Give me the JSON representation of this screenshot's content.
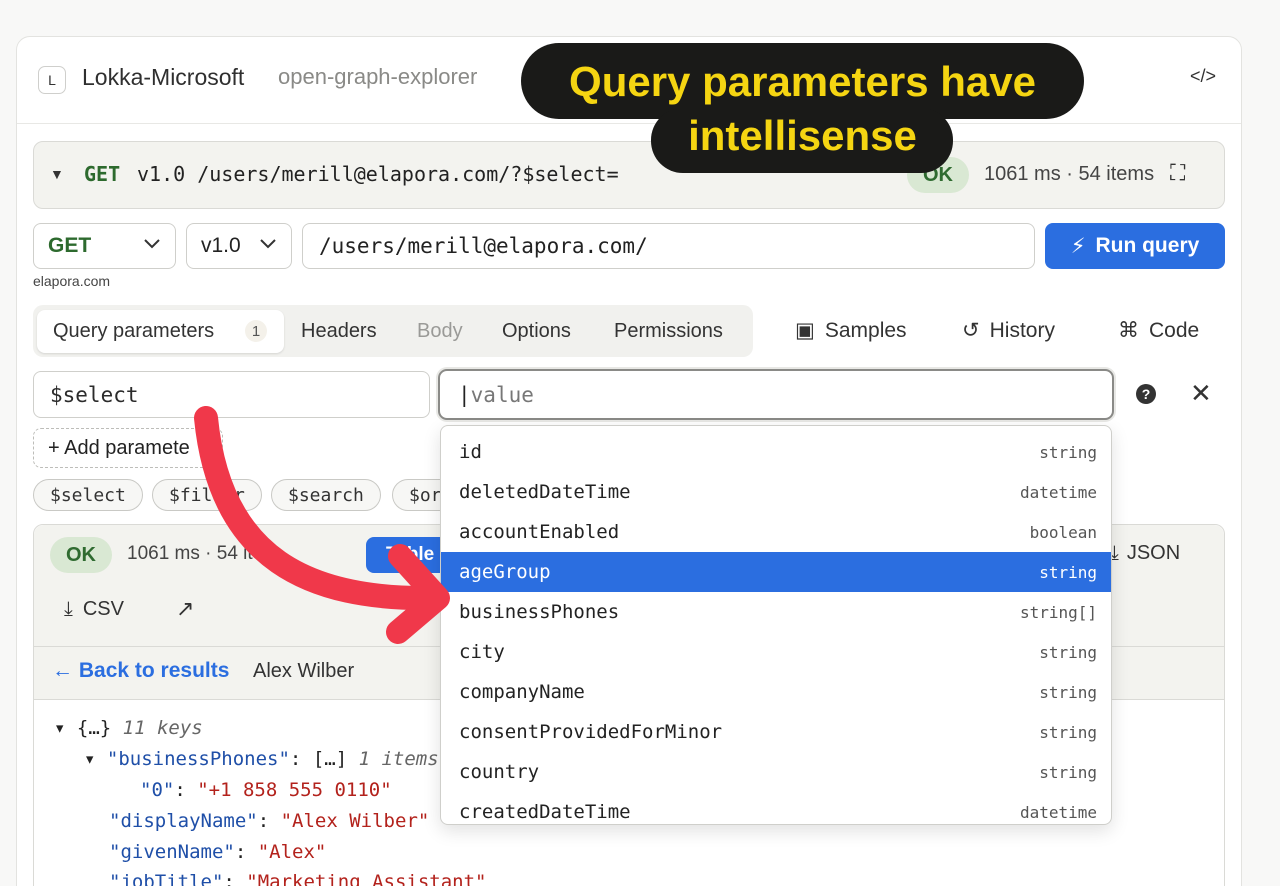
{
  "header": {
    "logo_letter": "L",
    "title": "Lokka-Microsoft",
    "subtitle": "open-graph-explorer",
    "code_icon": "</>"
  },
  "summary": {
    "method": "GET",
    "url": "v1.0 /users/merill@elapora.com/?$select=",
    "status": "OK",
    "stats": "1061 ms · 54 items"
  },
  "request": {
    "method": "GET",
    "version": "v1.0",
    "url": "/users/merill@elapora.com/",
    "run_label": "Run query",
    "domain_hint": "elapora.com"
  },
  "tabs": [
    {
      "label": "Query parameters",
      "count": "1"
    },
    {
      "label": "Headers"
    },
    {
      "label": "Body"
    },
    {
      "label": "Options"
    },
    {
      "label": "Permissions"
    }
  ],
  "tools": {
    "samples": "Samples",
    "history": "History",
    "code": "Code"
  },
  "param": {
    "key": "$select",
    "value_placeholder": "value",
    "add_label": "+ Add paramete",
    "chips": [
      "$select",
      "$filter",
      "$search",
      "$or"
    ]
  },
  "autocomplete": [
    {
      "name": "id",
      "type": "string"
    },
    {
      "name": "deletedDateTime",
      "type": "datetime"
    },
    {
      "name": "accountEnabled",
      "type": "boolean"
    },
    {
      "name": "ageGroup",
      "type": "string"
    },
    {
      "name": "businessPhones",
      "type": "string[]"
    },
    {
      "name": "city",
      "type": "string"
    },
    {
      "name": "companyName",
      "type": "string"
    },
    {
      "name": "consentProvidedForMinor",
      "type": "string"
    },
    {
      "name": "country",
      "type": "string"
    },
    {
      "name": "createdDateTime",
      "type": "datetime"
    }
  ],
  "autocomplete_selected_index": 3,
  "results": {
    "status": "OK",
    "stats": "1061 ms · 54 ite",
    "table_label": "Table",
    "json_label": "JSON",
    "csv_label": "CSV",
    "back_label": "Back to results",
    "record_name": "Alex Wilber"
  },
  "json_view": {
    "root": "{…}",
    "root_meta": "11 keys",
    "bp_key": "\"businessPhones\"",
    "bp_val": "[…]",
    "bp_meta": "1 items",
    "phone_key": "\"0\"",
    "phone_val": "\"+1 858 555 0110\"",
    "display_key": "\"displayName\"",
    "display_val": "\"Alex Wilber\"",
    "given_key": "\"givenName\"",
    "given_val": "\"Alex\"",
    "job_key": "\"jobTitle\"",
    "job_val": "\"Marketing Assistant\""
  },
  "annotation": {
    "text": "Query parameters have intellisense",
    "line1": "Query parameters have",
    "line2": "intellisense",
    "text_color": "#f5d512",
    "arrow_color": "#f0384a"
  },
  "colors": {
    "accent": "#2b6ee0",
    "method_green": "#2d6a2e",
    "ok_bg": "#d9e8d3"
  }
}
